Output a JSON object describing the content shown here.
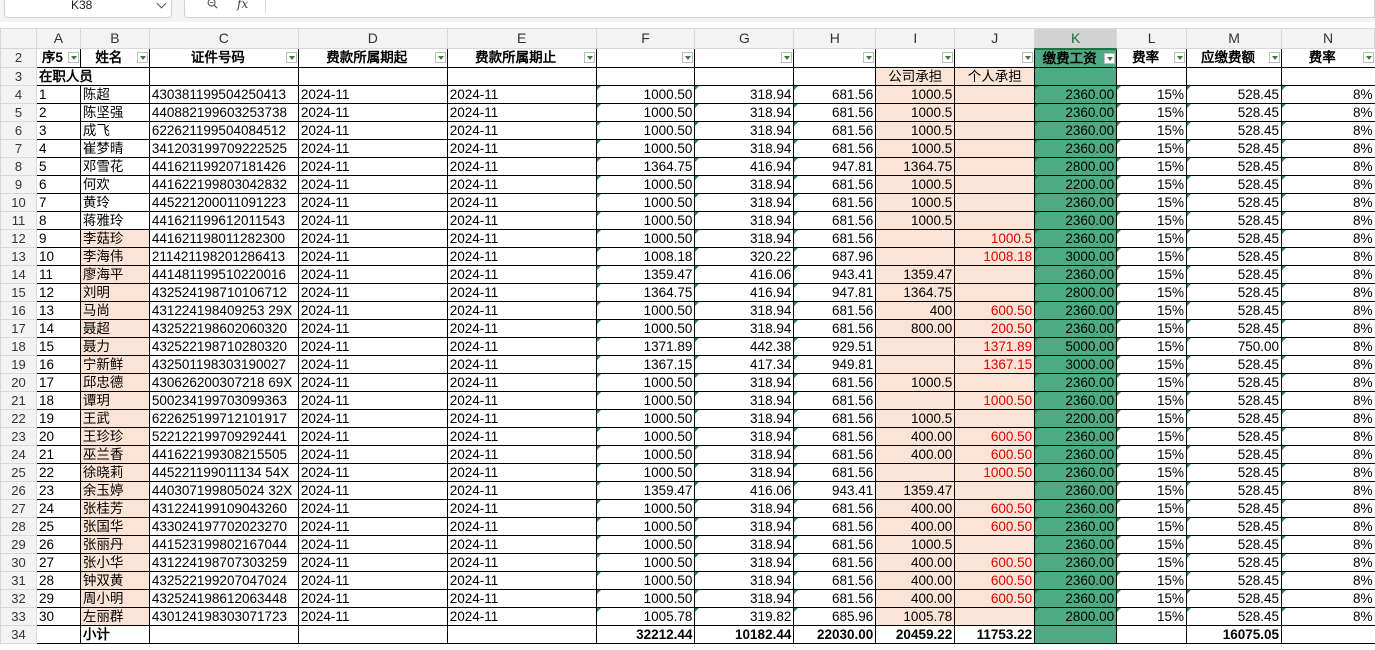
{
  "formula_bar": {
    "cell_ref": "K38",
    "fx": "fx"
  },
  "columns": [
    "A",
    "B",
    "C",
    "D",
    "E",
    "F",
    "G",
    "H",
    "I",
    "J",
    "K",
    "L",
    "M",
    "N"
  ],
  "selected_column": "K",
  "header_row": {
    "row": 2,
    "cells": [
      "序5",
      "姓名",
      "证件号码",
      "费款所属期起",
      "费款所属期止",
      "",
      "",
      "",
      "",
      "",
      "缴费工资",
      "费率",
      "应缴费额",
      "费率"
    ]
  },
  "section_row": {
    "row": 3,
    "label": "在职人员",
    "company": "公司承担",
    "personal": "个人承担"
  },
  "rows": [
    {
      "row": 4,
      "seq": "1",
      "name": "陈超",
      "id": "430381199504250413",
      "start": "2024-11",
      "end": "2024-11",
      "f": "1000.50",
      "g": "318.94",
      "h": "681.56",
      "i": "1000.5",
      "j": "",
      "k": "2360.00",
      "l": "15%",
      "m": "528.45",
      "n": "8%"
    },
    {
      "row": 5,
      "seq": "2",
      "name": "陈坚强",
      "id": "440882199603253738",
      "start": "2024-11",
      "end": "2024-11",
      "f": "1000.50",
      "g": "318.94",
      "h": "681.56",
      "i": "1000.5",
      "j": "",
      "k": "2360.00",
      "l": "15%",
      "m": "528.45",
      "n": "8%"
    },
    {
      "row": 6,
      "seq": "3",
      "name": "成飞",
      "id": "622621199504084512",
      "start": "2024-11",
      "end": "2024-11",
      "f": "1000.50",
      "g": "318.94",
      "h": "681.56",
      "i": "1000.5",
      "j": "",
      "k": "2360.00",
      "l": "15%",
      "m": "528.45",
      "n": "8%"
    },
    {
      "row": 7,
      "seq": "4",
      "name": "崔梦晴",
      "id": "341203199709222525",
      "start": "2024-11",
      "end": "2024-11",
      "f": "1000.50",
      "g": "318.94",
      "h": "681.56",
      "i": "1000.5",
      "j": "",
      "k": "2360.00",
      "l": "15%",
      "m": "528.45",
      "n": "8%"
    },
    {
      "row": 8,
      "seq": "5",
      "name": "邓雪花",
      "id": "441621199207181426",
      "start": "2024-11",
      "end": "2024-11",
      "f": "1364.75",
      "g": "416.94",
      "h": "947.81",
      "i": "1364.75",
      "j": "",
      "k": "2800.00",
      "l": "15%",
      "m": "528.45",
      "n": "8%"
    },
    {
      "row": 9,
      "seq": "6",
      "name": "何欢",
      "id": "441622199803042832",
      "start": "2024-11",
      "end": "2024-11",
      "f": "1000.50",
      "g": "318.94",
      "h": "681.56",
      "i": "1000.5",
      "j": "",
      "k": "2200.00",
      "l": "15%",
      "m": "528.45",
      "n": "8%"
    },
    {
      "row": 10,
      "seq": "7",
      "name": "黄玲",
      "id": "445221200011091223",
      "start": "2024-11",
      "end": "2024-11",
      "f": "1000.50",
      "g": "318.94",
      "h": "681.56",
      "i": "1000.5",
      "j": "",
      "k": "2360.00",
      "l": "15%",
      "m": "528.45",
      "n": "8%"
    },
    {
      "row": 11,
      "seq": "8",
      "name": "蒋雅玲",
      "id": "441621199612011543",
      "start": "2024-11",
      "end": "2024-11",
      "f": "1000.50",
      "g": "318.94",
      "h": "681.56",
      "i": "1000.5",
      "j": "",
      "k": "2360.00",
      "l": "15%",
      "m": "528.45",
      "n": "8%"
    },
    {
      "row": 12,
      "seq": "9",
      "name": "李菇珍",
      "id": "441621198011282300",
      "start": "2024-11",
      "end": "2024-11",
      "f": "1000.50",
      "g": "318.94",
      "h": "681.56",
      "i": "",
      "j": "1000.5",
      "k": "2360.00",
      "l": "15%",
      "m": "528.45",
      "n": "8%"
    },
    {
      "row": 13,
      "seq": "10",
      "name": "李海伟",
      "id": "211421198201286413",
      "start": "2024-11",
      "end": "2024-11",
      "f": "1008.18",
      "g": "320.22",
      "h": "687.96",
      "i": "",
      "j": "1008.18",
      "k": "3000.00",
      "l": "15%",
      "m": "528.45",
      "n": "8%"
    },
    {
      "row": 14,
      "seq": "11",
      "name": "廖海平",
      "id": "441481199510220016",
      "start": "2024-11",
      "end": "2024-11",
      "f": "1359.47",
      "g": "416.06",
      "h": "943.41",
      "i": "1359.47",
      "j": "",
      "k": "2360.00",
      "l": "15%",
      "m": "528.45",
      "n": "8%"
    },
    {
      "row": 15,
      "seq": "12",
      "name": "刘明",
      "id": "432524198710106712",
      "start": "2024-11",
      "end": "2024-11",
      "f": "1364.75",
      "g": "416.94",
      "h": "947.81",
      "i": "1364.75",
      "j": "",
      "k": "2800.00",
      "l": "15%",
      "m": "528.45",
      "n": "8%"
    },
    {
      "row": 16,
      "seq": "13",
      "name": "马尚",
      "id": "431224198409253 29X",
      "start": "2024-11",
      "end": "2024-11",
      "f": "1000.50",
      "g": "318.94",
      "h": "681.56",
      "i": "400",
      "j": "600.50",
      "k": "2360.00",
      "l": "15%",
      "m": "528.45",
      "n": "8%"
    },
    {
      "row": 17,
      "seq": "14",
      "name": "聂超",
      "id": "432522198602060320",
      "start": "2024-11",
      "end": "2024-11",
      "f": "1000.50",
      "g": "318.94",
      "h": "681.56",
      "i": "800.00",
      "j": "200.50",
      "k": "2360.00",
      "l": "15%",
      "m": "528.45",
      "n": "8%"
    },
    {
      "row": 18,
      "seq": "15",
      "name": "聂力",
      "id": "432522198710280320",
      "start": "2024-11",
      "end": "2024-11",
      "f": "1371.89",
      "g": "442.38",
      "h": "929.51",
      "i": "",
      "j": "1371.89",
      "k": "5000.00",
      "l": "15%",
      "m": "750.00",
      "n": "8%"
    },
    {
      "row": 19,
      "seq": "16",
      "name": "宁新鲜",
      "id": "432501198303190027",
      "start": "2024-11",
      "end": "2024-11",
      "f": "1367.15",
      "g": "417.34",
      "h": "949.81",
      "i": "",
      "j": "1367.15",
      "k": "3000.00",
      "l": "15%",
      "m": "528.45",
      "n": "8%"
    },
    {
      "row": 20,
      "seq": "17",
      "name": "邱忠德",
      "id": "430626200307218 69X",
      "start": "2024-11",
      "end": "2024-11",
      "f": "1000.50",
      "g": "318.94",
      "h": "681.56",
      "i": "1000.5",
      "j": "",
      "k": "2360.00",
      "l": "15%",
      "m": "528.45",
      "n": "8%"
    },
    {
      "row": 21,
      "seq": "18",
      "name": "谭玥",
      "id": "500234199703099363",
      "start": "2024-11",
      "end": "2024-11",
      "f": "1000.50",
      "g": "318.94",
      "h": "681.56",
      "i": "",
      "j": "1000.50",
      "k": "2360.00",
      "l": "15%",
      "m": "528.45",
      "n": "8%"
    },
    {
      "row": 22,
      "seq": "19",
      "name": "王武",
      "id": "622625199712101917",
      "start": "2024-11",
      "end": "2024-11",
      "f": "1000.50",
      "g": "318.94",
      "h": "681.56",
      "i": "1000.5",
      "j": "",
      "k": "2200.00",
      "l": "15%",
      "m": "528.45",
      "n": "8%"
    },
    {
      "row": 23,
      "seq": "20",
      "name": "王珍珍",
      "id": "522122199709292441",
      "start": "2024-11",
      "end": "2024-11",
      "f": "1000.50",
      "g": "318.94",
      "h": "681.56",
      "i": "400.00",
      "j": "600.50",
      "k": "2360.00",
      "l": "15%",
      "m": "528.45",
      "n": "8%"
    },
    {
      "row": 24,
      "seq": "21",
      "name": "巫兰香",
      "id": "441622199308215505",
      "start": "2024-11",
      "end": "2024-11",
      "f": "1000.50",
      "g": "318.94",
      "h": "681.56",
      "i": "400.00",
      "j": "600.50",
      "k": "2360.00",
      "l": "15%",
      "m": "528.45",
      "n": "8%"
    },
    {
      "row": 25,
      "seq": "22",
      "name": "徐晓莉",
      "id": "445221199011134 54X",
      "start": "2024-11",
      "end": "2024-11",
      "f": "1000.50",
      "g": "318.94",
      "h": "681.56",
      "i": "",
      "j": "1000.50",
      "k": "2360.00",
      "l": "15%",
      "m": "528.45",
      "n": "8%"
    },
    {
      "row": 26,
      "seq": "23",
      "name": "余玉婷",
      "id": "440307199805024 32X",
      "start": "2024-11",
      "end": "2024-11",
      "f": "1359.47",
      "g": "416.06",
      "h": "943.41",
      "i": "1359.47",
      "j": "",
      "k": "2360.00",
      "l": "15%",
      "m": "528.45",
      "n": "8%"
    },
    {
      "row": 27,
      "seq": "24",
      "name": "张桂芳",
      "id": "431224199109043260",
      "start": "2024-11",
      "end": "2024-11",
      "f": "1000.50",
      "g": "318.94",
      "h": "681.56",
      "i": "400.00",
      "j": "600.50",
      "k": "2360.00",
      "l": "15%",
      "m": "528.45",
      "n": "8%"
    },
    {
      "row": 28,
      "seq": "25",
      "name": "张国华",
      "id": "433024197702023270",
      "start": "2024-11",
      "end": "2024-11",
      "f": "1000.50",
      "g": "318.94",
      "h": "681.56",
      "i": "400.00",
      "j": "600.50",
      "k": "2360.00",
      "l": "15%",
      "m": "528.45",
      "n": "8%"
    },
    {
      "row": 29,
      "seq": "26",
      "name": "张丽丹",
      "id": "441523199802167044",
      "start": "2024-11",
      "end": "2024-11",
      "f": "1000.50",
      "g": "318.94",
      "h": "681.56",
      "i": "1000.5",
      "j": "",
      "k": "2360.00",
      "l": "15%",
      "m": "528.45",
      "n": "8%"
    },
    {
      "row": 30,
      "seq": "27",
      "name": "张小华",
      "id": "431224198707303259",
      "start": "2024-11",
      "end": "2024-11",
      "f": "1000.50",
      "g": "318.94",
      "h": "681.56",
      "i": "400.00",
      "j": "600.50",
      "k": "2360.00",
      "l": "15%",
      "m": "528.45",
      "n": "8%"
    },
    {
      "row": 31,
      "seq": "28",
      "name": "钟双黄",
      "id": "432522199207047024",
      "start": "2024-11",
      "end": "2024-11",
      "f": "1000.50",
      "g": "318.94",
      "h": "681.56",
      "i": "400.00",
      "j": "600.50",
      "k": "2360.00",
      "l": "15%",
      "m": "528.45",
      "n": "8%"
    },
    {
      "row": 32,
      "seq": "29",
      "name": "周小明",
      "id": "432524198612063448",
      "start": "2024-11",
      "end": "2024-11",
      "f": "1000.50",
      "g": "318.94",
      "h": "681.56",
      "i": "400.00",
      "j": "600.50",
      "k": "2360.00",
      "l": "15%",
      "m": "528.45",
      "n": "8%"
    },
    {
      "row": 33,
      "seq": "30",
      "name": "左丽群",
      "id": "430124198303071723",
      "start": "2024-11",
      "end": "2024-11",
      "f": "1005.78",
      "g": "319.82",
      "h": "685.96",
      "i": "1005.78",
      "j": "",
      "k": "2800.00",
      "l": "15%",
      "m": "528.45",
      "n": "8%"
    }
  ],
  "total_row": {
    "row": 34,
    "label": "小计",
    "f": "32212.44",
    "g": "10182.44",
    "h": "22030.00",
    "i": "20459.22",
    "j": "11753.22",
    "m": "16075.05"
  },
  "colors": {
    "peach": "#fbe4d5",
    "teal": "#4eaa83",
    "red_text": "#e00000",
    "filter_green": "#217346"
  }
}
